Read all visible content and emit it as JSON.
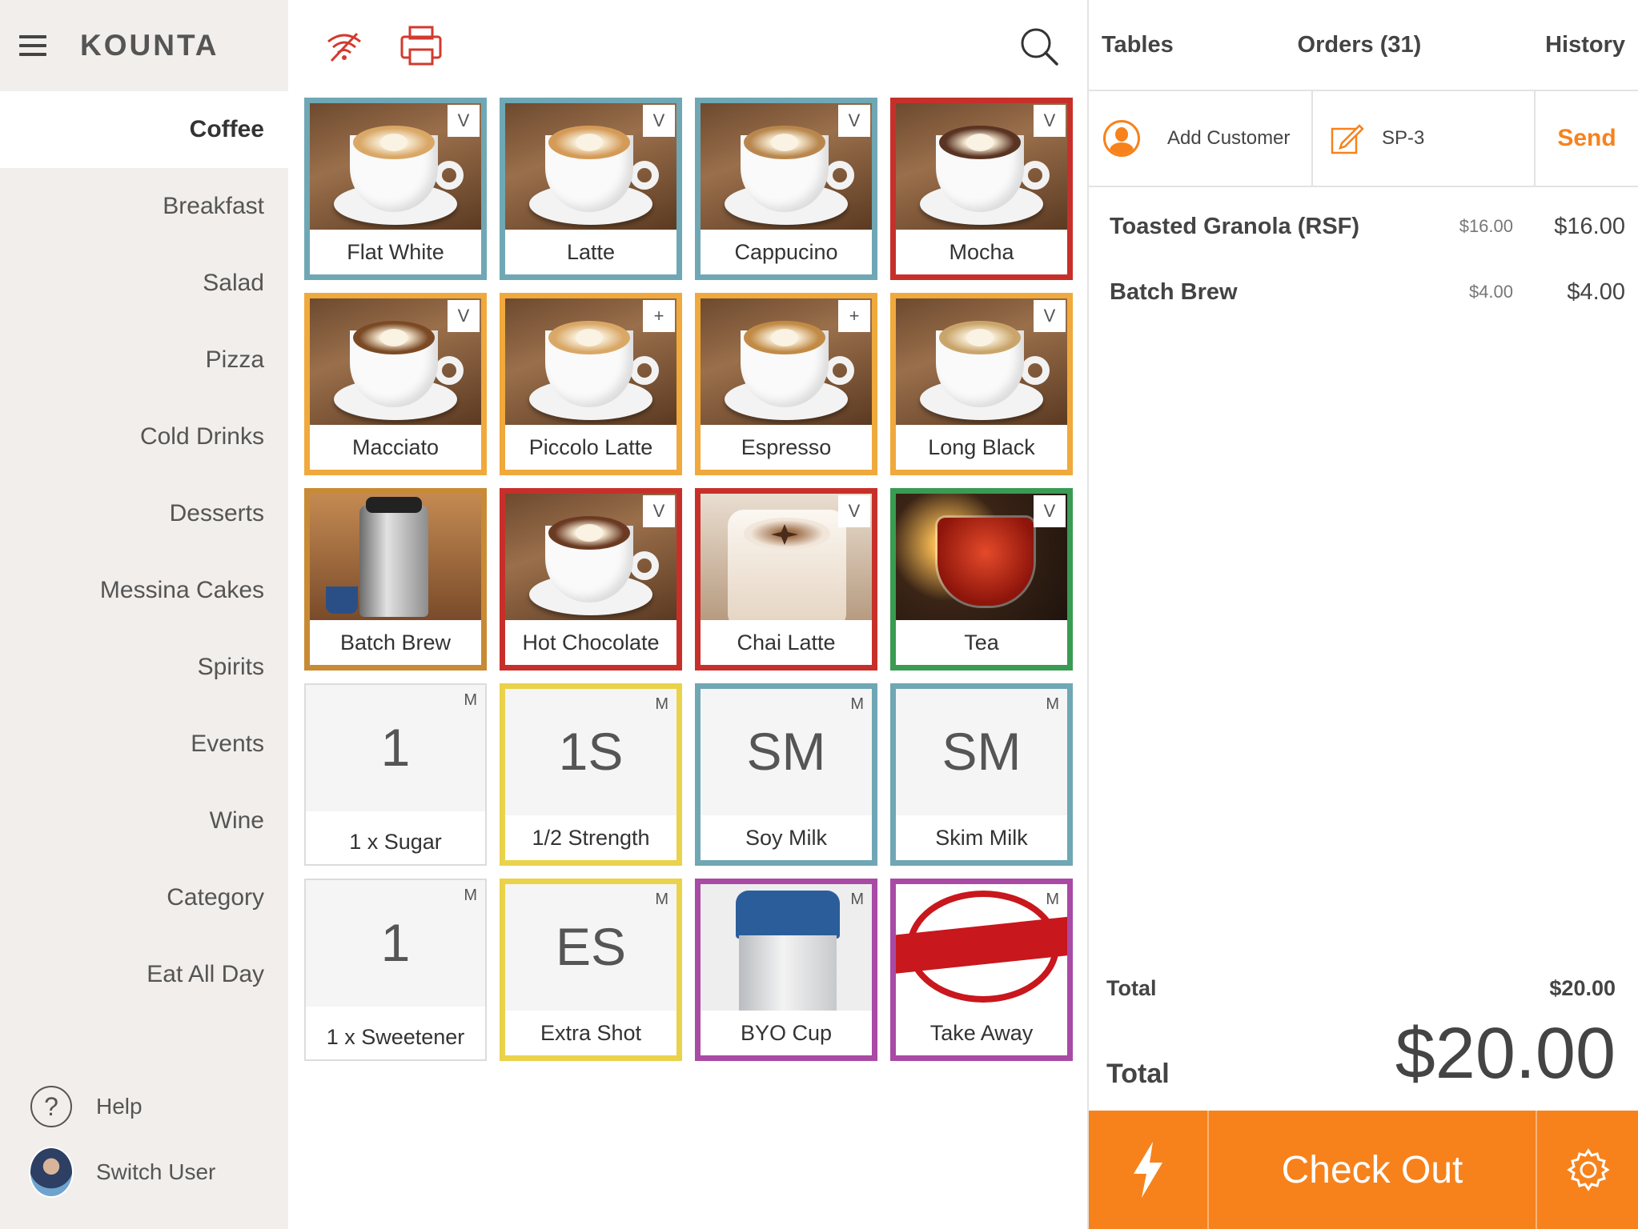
{
  "sidebar": {
    "logo": "KOUNTA",
    "categories": [
      {
        "label": "Coffee",
        "active": true
      },
      {
        "label": "Breakfast"
      },
      {
        "label": "Salad"
      },
      {
        "label": "Pizza"
      },
      {
        "label": "Cold Drinks"
      },
      {
        "label": "Desserts"
      },
      {
        "label": "Messina Cakes"
      },
      {
        "label": "Spirits"
      },
      {
        "label": "Events"
      },
      {
        "label": "Wine"
      },
      {
        "label": "Category"
      },
      {
        "label": "Eat All Day"
      }
    ],
    "help_label": "Help",
    "switch_user_label": "Switch User"
  },
  "toolbar": {
    "icons": [
      "wifi-off-icon",
      "printer-icon",
      "search-icon"
    ]
  },
  "products": [
    {
      "label": "Flat White",
      "badge": "V",
      "border": "#6fa7b4",
      "foam": "#d9a766"
    },
    {
      "label": "Latte",
      "badge": "V",
      "border": "#6fa7b4",
      "foam": "#d49a57"
    },
    {
      "label": "Cappucino",
      "badge": "V",
      "border": "#6fa7b4",
      "foam": "#b9874e"
    },
    {
      "label": "Mocha",
      "badge": "V",
      "border": "#c7302a",
      "foam": "#5a3322"
    },
    {
      "label": "Macciato",
      "badge": "V",
      "border": "#f0a93c",
      "foam": "#7b4a25"
    },
    {
      "label": "Piccolo Latte",
      "badge": "+",
      "border": "#f0a93c",
      "foam": "#d9a766"
    },
    {
      "label": "Espresso",
      "badge": "+",
      "border": "#f0a93c",
      "foam": "#c18a45"
    },
    {
      "label": "Long Black",
      "badge": "V",
      "border": "#f0a93c",
      "foam": "#c9a56b"
    },
    {
      "label": "Batch Brew",
      "badge": "",
      "border": "#c88b34",
      "foam": ""
    },
    {
      "label": "Hot Chocolate",
      "badge": "V",
      "border": "#c7302a",
      "foam": "#6b3a23"
    },
    {
      "label": "Chai Latte",
      "badge": "V",
      "border": "#c7302a",
      "foam": ""
    },
    {
      "label": "Tea",
      "badge": "V",
      "border": "#3a9b52",
      "foam": ""
    }
  ],
  "modifiers": [
    {
      "code": "1",
      "label": "1 x Sugar",
      "badge": "M",
      "border": "#dcdcdc"
    },
    {
      "code": "1S",
      "label": "1/2 Strength",
      "badge": "M",
      "border": "#ead24a"
    },
    {
      "code": "SM",
      "label": "Soy Milk",
      "badge": "M",
      "border": "#6fa7b4"
    },
    {
      "code": "SM",
      "label": "Skim Milk",
      "badge": "M",
      "border": "#6fa7b4"
    },
    {
      "code": "1",
      "label": "1 x Sweetener",
      "badge": "M",
      "border": "#dcdcdc"
    },
    {
      "code": "ES",
      "label": "Extra Shot",
      "badge": "M",
      "border": "#ead24a"
    },
    {
      "code": "",
      "label": "BYO Cup",
      "badge": "M",
      "border": "#a94aa5"
    },
    {
      "code": "",
      "label": "Take Away",
      "badge": "M",
      "border": "#a94aa5"
    }
  ],
  "order": {
    "tabs": [
      "Tables",
      "Orders (31)",
      "History"
    ],
    "add_customer_label": "Add Customer",
    "reference": "SP-3",
    "send_label": "Send",
    "lines": [
      {
        "name": "Toasted Granola (RSF)",
        "unit": "$16.00",
        "total": "$16.00"
      },
      {
        "name": "Batch Brew",
        "unit": "$4.00",
        "total": "$4.00"
      }
    ],
    "subtotal_label": "Total",
    "subtotal_value": "$20.00",
    "total_label": "Total",
    "total_value": "$20.00",
    "checkout_label": "Check Out"
  },
  "colors": {
    "accent": "#f7821b",
    "sidebar_bg": "#f1eeeb"
  }
}
